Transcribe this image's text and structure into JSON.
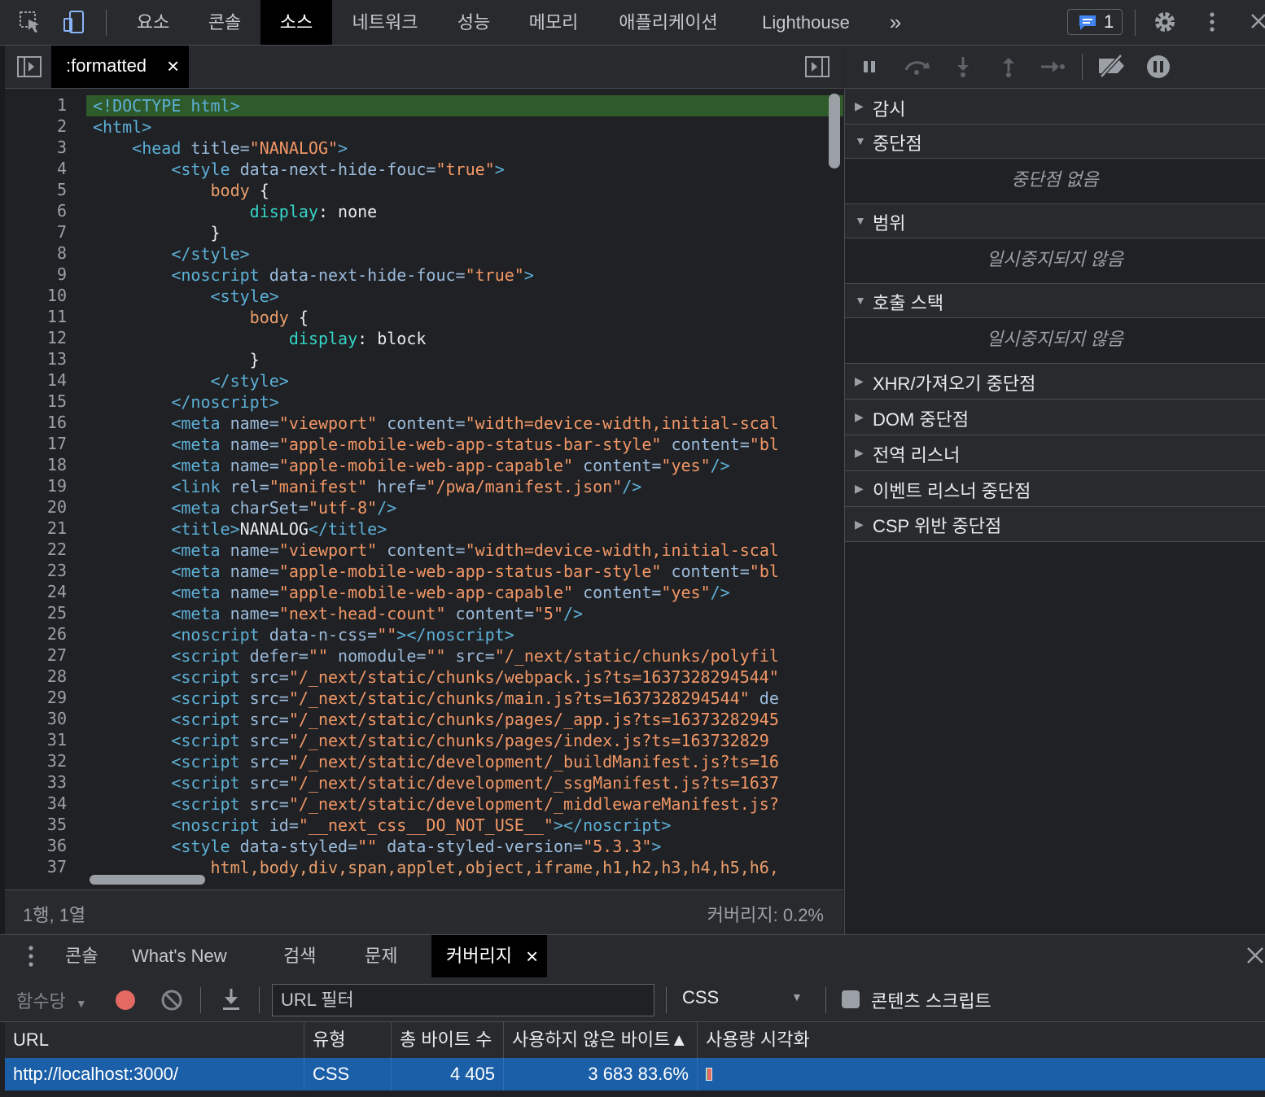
{
  "toolbar": {
    "tabs": [
      "요소",
      "콘솔",
      "소스",
      "네트워크",
      "성능",
      "메모리",
      "애플리케이션",
      "Lighthouse"
    ],
    "active_tab": "소스",
    "more_tabs": "»",
    "issues_count": "1"
  },
  "editor": {
    "file_tab": ":formatted",
    "close": "×",
    "line_numbers": [
      "1",
      "2",
      "3",
      "4",
      "5",
      "6",
      "7",
      "8",
      "9",
      "10",
      "11",
      "12",
      "13",
      "14",
      "15",
      "16",
      "17",
      "18",
      "19",
      "20",
      "21",
      "22",
      "23",
      "24",
      "25",
      "26",
      "27",
      "28",
      "29",
      "30",
      "31",
      "32",
      "33",
      "34",
      "35",
      "36",
      "37"
    ],
    "lines": [
      [
        [
          "tag",
          "<!DOCTYPE html>"
        ]
      ],
      [
        [
          "tag",
          "<html>"
        ]
      ],
      [
        [
          "pln",
          "    "
        ],
        [
          "tag",
          "<head "
        ],
        [
          "attr",
          "title="
        ],
        [
          "val",
          "\"NANALOG\""
        ],
        [
          "tag",
          ">"
        ]
      ],
      [
        [
          "pln",
          "        "
        ],
        [
          "tag",
          "<style "
        ],
        [
          "attr",
          "data-next-hide-fouc="
        ],
        [
          "val",
          "\"true\""
        ],
        [
          "tag",
          ">"
        ]
      ],
      [
        [
          "pln",
          "            "
        ],
        [
          "kw",
          "body"
        ],
        [
          "pln",
          " {"
        ]
      ],
      [
        [
          "pln",
          "                "
        ],
        [
          "prop",
          "display"
        ],
        [
          "pln",
          ": none"
        ]
      ],
      [
        [
          "pln",
          "            }"
        ]
      ],
      [
        [
          "pln",
          "        "
        ],
        [
          "tag",
          "</style>"
        ]
      ],
      [
        [
          "pln",
          "        "
        ],
        [
          "tag",
          "<noscript "
        ],
        [
          "attr",
          "data-next-hide-fouc="
        ],
        [
          "val",
          "\"true\""
        ],
        [
          "tag",
          ">"
        ]
      ],
      [
        [
          "pln",
          "            "
        ],
        [
          "tag",
          "<style>"
        ]
      ],
      [
        [
          "pln",
          "                "
        ],
        [
          "kw",
          "body"
        ],
        [
          "pln",
          " {"
        ]
      ],
      [
        [
          "pln",
          "                    "
        ],
        [
          "prop",
          "display"
        ],
        [
          "pln",
          ": block"
        ]
      ],
      [
        [
          "pln",
          "                }"
        ]
      ],
      [
        [
          "pln",
          "            "
        ],
        [
          "tag",
          "</style>"
        ]
      ],
      [
        [
          "pln",
          "        "
        ],
        [
          "tag",
          "</noscript>"
        ]
      ],
      [
        [
          "pln",
          "        "
        ],
        [
          "tag",
          "<meta "
        ],
        [
          "attr",
          "name="
        ],
        [
          "val",
          "\"viewport\""
        ],
        [
          "attr",
          " content="
        ],
        [
          "val",
          "\"width=device-width,initial-scal"
        ]
      ],
      [
        [
          "pln",
          "        "
        ],
        [
          "tag",
          "<meta "
        ],
        [
          "attr",
          "name="
        ],
        [
          "val",
          "\"apple-mobile-web-app-status-bar-style\""
        ],
        [
          "attr",
          " content="
        ],
        [
          "val",
          "\"bl"
        ]
      ],
      [
        [
          "pln",
          "        "
        ],
        [
          "tag",
          "<meta "
        ],
        [
          "attr",
          "name="
        ],
        [
          "val",
          "\"apple-mobile-web-app-capable\""
        ],
        [
          "attr",
          " content="
        ],
        [
          "val",
          "\"yes\""
        ],
        [
          "tag",
          "/>"
        ]
      ],
      [
        [
          "pln",
          "        "
        ],
        [
          "tag",
          "<link "
        ],
        [
          "attr",
          "rel="
        ],
        [
          "val",
          "\"manifest\""
        ],
        [
          "attr",
          " href="
        ],
        [
          "val",
          "\"/pwa/manifest.json\""
        ],
        [
          "tag",
          "/>"
        ]
      ],
      [
        [
          "pln",
          "        "
        ],
        [
          "tag",
          "<meta "
        ],
        [
          "attr",
          "charSet="
        ],
        [
          "val",
          "\"utf-8\""
        ],
        [
          "tag",
          "/>"
        ]
      ],
      [
        [
          "pln",
          "        "
        ],
        [
          "tag",
          "<title>"
        ],
        [
          "pln",
          "NANALOG"
        ],
        [
          "tag",
          "</title>"
        ]
      ],
      [
        [
          "pln",
          "        "
        ],
        [
          "tag",
          "<meta "
        ],
        [
          "attr",
          "name="
        ],
        [
          "val",
          "\"viewport\""
        ],
        [
          "attr",
          " content="
        ],
        [
          "val",
          "\"width=device-width,initial-scal"
        ]
      ],
      [
        [
          "pln",
          "        "
        ],
        [
          "tag",
          "<meta "
        ],
        [
          "attr",
          "name="
        ],
        [
          "val",
          "\"apple-mobile-web-app-status-bar-style\""
        ],
        [
          "attr",
          " content="
        ],
        [
          "val",
          "\"bl"
        ]
      ],
      [
        [
          "pln",
          "        "
        ],
        [
          "tag",
          "<meta "
        ],
        [
          "attr",
          "name="
        ],
        [
          "val",
          "\"apple-mobile-web-app-capable\""
        ],
        [
          "attr",
          " content="
        ],
        [
          "val",
          "\"yes\""
        ],
        [
          "tag",
          "/>"
        ]
      ],
      [
        [
          "pln",
          "        "
        ],
        [
          "tag",
          "<meta "
        ],
        [
          "attr",
          "name="
        ],
        [
          "val",
          "\"next-head-count\""
        ],
        [
          "attr",
          " content="
        ],
        [
          "val",
          "\"5\""
        ],
        [
          "tag",
          "/>"
        ]
      ],
      [
        [
          "pln",
          "        "
        ],
        [
          "tag",
          "<noscript "
        ],
        [
          "attr",
          "data-n-css="
        ],
        [
          "val",
          "\"\""
        ],
        [
          "tag",
          "></noscript>"
        ]
      ],
      [
        [
          "pln",
          "        "
        ],
        [
          "tag",
          "<script "
        ],
        [
          "attr",
          "defer="
        ],
        [
          "val",
          "\"\""
        ],
        [
          "attr",
          " nomodule="
        ],
        [
          "val",
          "\"\""
        ],
        [
          "attr",
          " src="
        ],
        [
          "val",
          "\"/_next/static/chunks/polyfil"
        ]
      ],
      [
        [
          "pln",
          "        "
        ],
        [
          "tag",
          "<script "
        ],
        [
          "attr",
          "src="
        ],
        [
          "val",
          "\"/_next/static/chunks/webpack.js?ts=1637328294544\""
        ]
      ],
      [
        [
          "pln",
          "        "
        ],
        [
          "tag",
          "<script "
        ],
        [
          "attr",
          "src="
        ],
        [
          "val",
          "\"/_next/static/chunks/main.js?ts=1637328294544\""
        ],
        [
          "attr",
          " de"
        ]
      ],
      [
        [
          "pln",
          "        "
        ],
        [
          "tag",
          "<script "
        ],
        [
          "attr",
          "src="
        ],
        [
          "val",
          "\"/_next/static/chunks/pages/_app.js?ts=16373282945"
        ]
      ],
      [
        [
          "pln",
          "        "
        ],
        [
          "tag",
          "<script "
        ],
        [
          "attr",
          "src="
        ],
        [
          "val",
          "\"/_next/static/chunks/pages/index.js?ts=163732829"
        ]
      ],
      [
        [
          "pln",
          "        "
        ],
        [
          "tag",
          "<script "
        ],
        [
          "attr",
          "src="
        ],
        [
          "val",
          "\"/_next/static/development/_buildManifest.js?ts=16"
        ]
      ],
      [
        [
          "pln",
          "        "
        ],
        [
          "tag",
          "<script "
        ],
        [
          "attr",
          "src="
        ],
        [
          "val",
          "\"/_next/static/development/_ssgManifest.js?ts=1637"
        ]
      ],
      [
        [
          "pln",
          "        "
        ],
        [
          "tag",
          "<script "
        ],
        [
          "attr",
          "src="
        ],
        [
          "val",
          "\"/_next/static/development/_middlewareManifest.js?"
        ]
      ],
      [
        [
          "pln",
          "        "
        ],
        [
          "tag",
          "<noscript "
        ],
        [
          "attr",
          "id="
        ],
        [
          "val",
          "\"__next_css__DO_NOT_USE__\""
        ],
        [
          "tag",
          "></noscript>"
        ]
      ],
      [
        [
          "pln",
          "        "
        ],
        [
          "tag",
          "<style "
        ],
        [
          "attr",
          "data-styled="
        ],
        [
          "val",
          "\"\""
        ],
        [
          "attr",
          " data-styled-version="
        ],
        [
          "val",
          "\"5.3.3\""
        ],
        [
          "tag",
          ">"
        ]
      ],
      [
        [
          "pln",
          "            "
        ],
        [
          "kw",
          "html,body,div,span,applet,object,iframe,h1,h2,h3,h4,h5,h6,"
        ]
      ]
    ],
    "status_position": "1행, 1열",
    "status_coverage": "커버리지: 0.2%"
  },
  "debugger": {
    "sections": [
      {
        "label": "감시",
        "expanded": false
      },
      {
        "label": "중단점",
        "expanded": true,
        "empty": "중단점 없음"
      },
      {
        "label": "범위",
        "expanded": true,
        "empty": "일시중지되지 않음"
      },
      {
        "label": "호출 스택",
        "expanded": true,
        "empty": "일시중지되지 않음"
      },
      {
        "label": "XHR/가져오기 중단점",
        "expanded": false
      },
      {
        "label": "DOM 중단점",
        "expanded": false
      },
      {
        "label": "전역 리스너",
        "expanded": false
      },
      {
        "label": "이벤트 리스너 중단점",
        "expanded": false
      },
      {
        "label": "CSP 위반 중단점",
        "expanded": false
      }
    ]
  },
  "drawer": {
    "tabs": [
      "콘솔",
      "What's New",
      "검색",
      "문제",
      "커버리지"
    ],
    "active_tab": "커버리지",
    "close": "×"
  },
  "coverage": {
    "granularity": "함수당",
    "url_filter_placeholder": "URL 필터",
    "type_filter": "CSS",
    "content_scripts_label": "콘텐츠 스크립트",
    "columns": [
      "URL",
      "유형",
      "총 바이트 수",
      "사용하지 않은 바이트▲",
      "사용량 시각화"
    ],
    "rows": [
      {
        "url": "http://localhost:3000/",
        "type": "CSS",
        "total": "4 405",
        "unused": "3 683",
        "unused_pct": "83.6%",
        "used_fraction": 0.164
      }
    ]
  },
  "colors": {
    "tag": "#5db0d7",
    "attr": "#9bbbdc",
    "value": "#f29766",
    "selected_row": "#1a5fa8",
    "record": "#e46962"
  }
}
